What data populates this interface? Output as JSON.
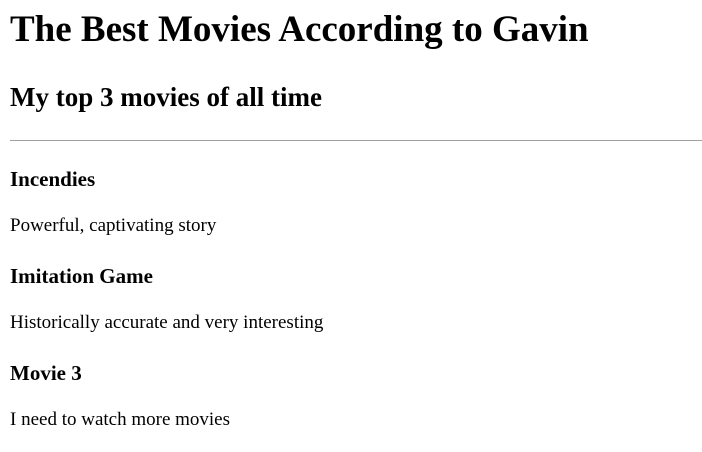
{
  "page": {
    "title": "The Best Movies According to Gavin",
    "subtitle": "My top 3 movies of all time"
  },
  "movies": [
    {
      "title": "Incendies",
      "description": "Powerful, captivating story"
    },
    {
      "title": "Imitation Game",
      "description": "Historically accurate and very interesting"
    },
    {
      "title": "Movie 3",
      "description": "I need to watch more movies"
    }
  ]
}
